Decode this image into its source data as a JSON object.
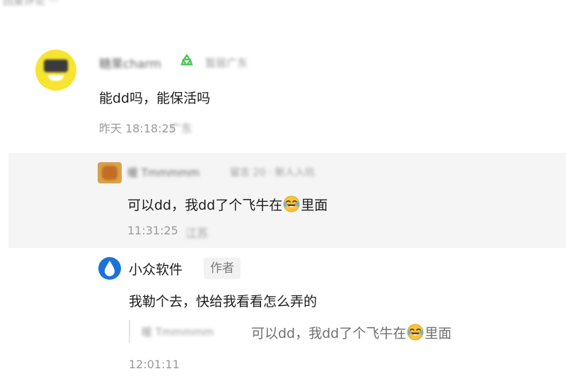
{
  "top_cropped_text": "回复评论 ···",
  "comment": {
    "user_name": "糖果charm",
    "user_meta": "暂居广东",
    "text": "能dd吗，能保活吗",
    "time": "昨天 18:18:25",
    "location": "广东"
  },
  "reply": {
    "user_name": "暖 Tmmmmm",
    "user_meta": "留言 20 · 新人入坑",
    "text_before_emoji": "可以dd，我dd了个飞牛在",
    "emoji": "tears-of-joy-emoji",
    "text_after_emoji": "里面",
    "time": "11:31:25",
    "location": "江苏"
  },
  "author_reply": {
    "author_name": "小众软件",
    "author_badge": "作者",
    "text": "我勒个去，快给我看看怎么弄的",
    "quote_name": "暖 Tmmmmm",
    "quote_text_before_emoji": "可以dd，我dd了个飞牛在",
    "quote_text_after_emoji": "里面",
    "time": "12:01:11"
  },
  "colors": {
    "reply_background": "#f5f5f5",
    "author_logo": "#1a73d9",
    "badge_green": "#4cc65d",
    "avatar_yellow": "#f7e531"
  }
}
